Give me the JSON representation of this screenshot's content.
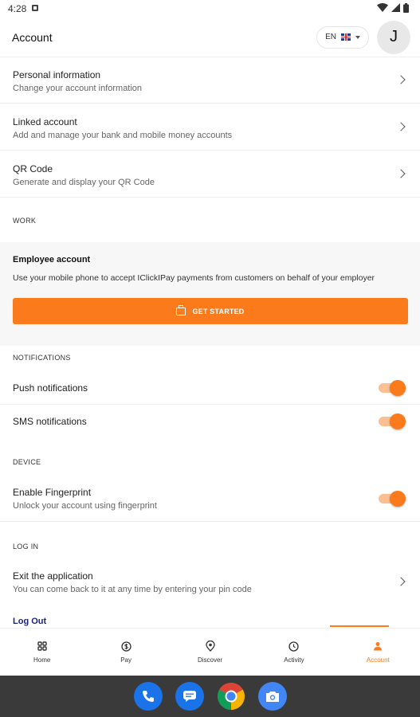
{
  "status_bar": {
    "time": "4:28"
  },
  "header": {
    "title": "Account",
    "language": "EN",
    "avatar_initial": "J"
  },
  "account_rows": [
    {
      "title": "Personal information",
      "subtitle": "Change your account information"
    },
    {
      "title": "Linked account",
      "subtitle": "Add and manage your bank and mobile money accounts"
    },
    {
      "title": "QR Code",
      "subtitle": "Generate and display your QR Code"
    }
  ],
  "work": {
    "section_label": "WORK",
    "employee_title": "Employee account",
    "employee_desc": "Use your mobile phone to accept IClickIPay payments from customers on behalf of your employer",
    "button_label": "GET STARTED"
  },
  "notifications": {
    "section_label": "NOTIFICATIONS",
    "push_label": "Push notifications",
    "sms_label": "SMS notifications",
    "push_enabled": true,
    "sms_enabled": true
  },
  "device": {
    "section_label": "DEVICE",
    "fingerprint_title": "Enable Fingerprint",
    "fingerprint_sub": "Unlock your account using fingerprint",
    "fingerprint_enabled": true
  },
  "login": {
    "section_label": "LOG IN",
    "exit_title": "Exit the application",
    "exit_sub": "You can come back to it at any time by entering your pin code",
    "logout_label": "Log Out"
  },
  "bottom_nav": [
    {
      "label": "Home",
      "icon": "grid-icon"
    },
    {
      "label": "Pay",
      "icon": "dollar-circle-icon"
    },
    {
      "label": "Discover",
      "icon": "location-pin-icon"
    },
    {
      "label": "Activity",
      "icon": "clock-icon"
    },
    {
      "label": "Account",
      "icon": "person-icon",
      "active": true
    }
  ],
  "colors": {
    "accent": "#fb7a1c",
    "logout": "#1a237e",
    "system_nav": "#3a3a3a"
  }
}
